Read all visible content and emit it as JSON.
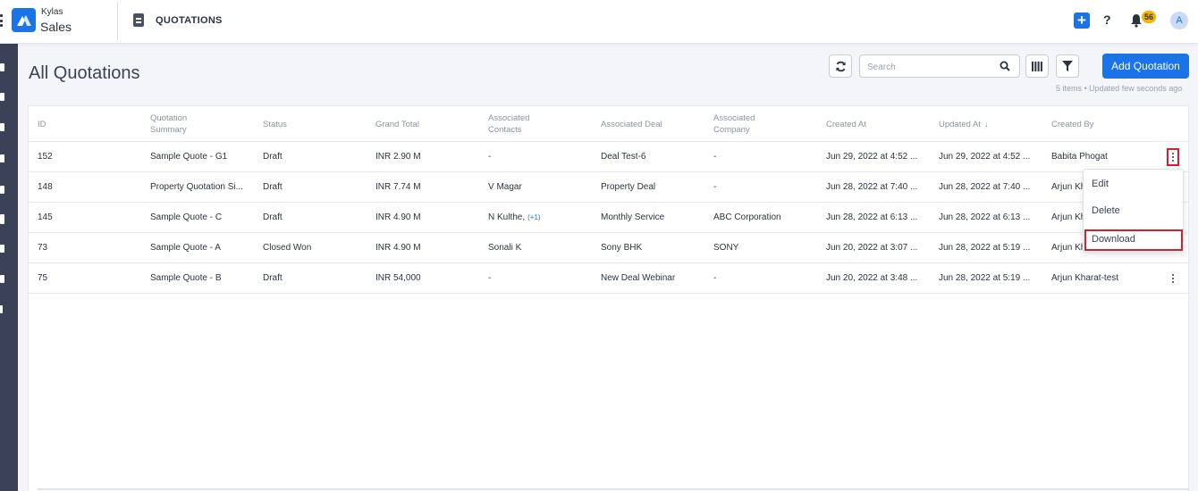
{
  "app": {
    "brand_top": "Kylas",
    "brand_main": "Sales",
    "module_title": "QUOTATIONS",
    "accent_color": "#1a73e8",
    "highlight_color": "#d6202e"
  },
  "header_actions": {
    "plus_label": "+",
    "help_label": "?",
    "notification_count": "56",
    "avatar_initial": "A"
  },
  "page": {
    "title": "All Quotations",
    "search_placeholder": "Search",
    "add_button": "Add Quotation",
    "meta": "5 items • Updated few seconds ago"
  },
  "table": {
    "columns": [
      "ID",
      "Quotation Summary",
      "Status",
      "Grand Total",
      "Associated Contacts",
      "Associated Deal",
      "Associated Company",
      "Created At",
      "Updated At",
      "Created By"
    ],
    "rows": [
      {
        "id": "152",
        "summary": "Sample Quote - G1",
        "status": "Draft",
        "total": "INR 2.90 M",
        "contacts": "-",
        "contacts_more": "",
        "deal": "Deal Test-6",
        "company": "-",
        "created": "Jun 29, 2022 at 4:52 ...",
        "updated": "Jun 29, 2022 at 4:52 ...",
        "created_by": "Babita Phogat"
      },
      {
        "id": "148",
        "summary": "Property Quotation Si...",
        "status": "Draft",
        "total": "INR 7.74 M",
        "contacts": "V Magar",
        "contacts_more": "",
        "deal": "Property Deal",
        "company": "-",
        "created": "Jun 28, 2022 at 7:40 ...",
        "updated": "Jun 28, 2022 at 7:40 ...",
        "created_by": "Arjun Kh"
      },
      {
        "id": "145",
        "summary": "Sample Quote - C",
        "status": "Draft",
        "total": "INR 4.90 M",
        "contacts": "N Kulthe,",
        "contacts_more": "(+1)",
        "deal": "Monthly Service",
        "company": "ABC Corporation",
        "created": "Jun 28, 2022 at 6:13 ...",
        "updated": "Jun 28, 2022 at 6:13 ...",
        "created_by": "Arjun Kh"
      },
      {
        "id": "73",
        "summary": "Sample Quote - A",
        "status": "Closed Won",
        "total": "INR 4.90 M",
        "contacts": "Sonali K",
        "contacts_more": "",
        "deal": "Sony BHK",
        "company": "SONY",
        "created": "Jun 20, 2022 at 3:07 ...",
        "updated": "Jun 28, 2022 at 5:19 ...",
        "created_by": "Arjun Kh"
      },
      {
        "id": "75",
        "summary": "Sample Quote - B",
        "status": "Draft",
        "total": "INR 54,000",
        "contacts": "-",
        "contacts_more": "",
        "deal": "New Deal Webinar",
        "company": "-",
        "created": "Jun 20, 2022 at 3:48 ...",
        "updated": "Jun 28, 2022 at 5:19 ...",
        "created_by": "Arjun Kharat-test"
      }
    ]
  },
  "row_menu": {
    "items": [
      "Edit",
      "Delete",
      "Download"
    ]
  }
}
